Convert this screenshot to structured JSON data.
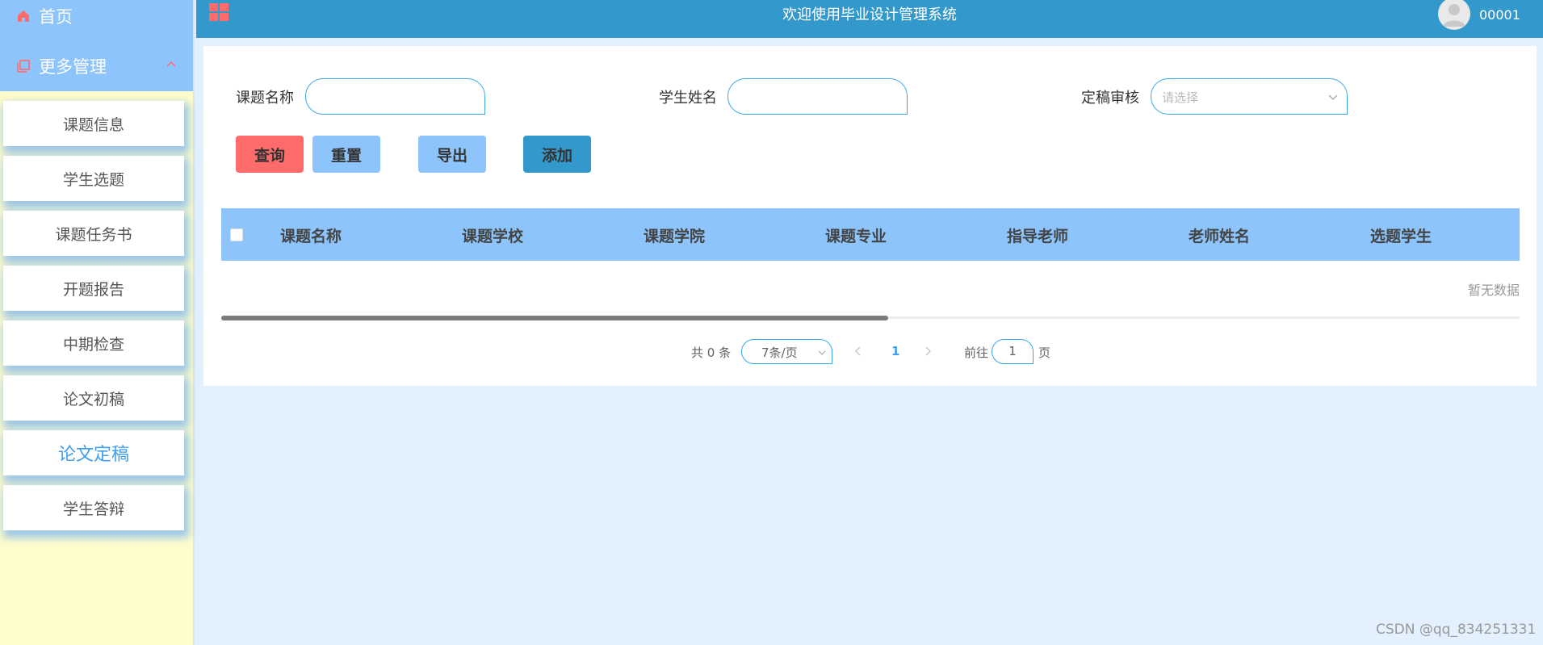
{
  "sidebar": {
    "home_label": "首页",
    "more_label": "更多管理",
    "items": [
      {
        "label": "课题信息"
      },
      {
        "label": "学生选题"
      },
      {
        "label": "课题任务书"
      },
      {
        "label": "开题报告"
      },
      {
        "label": "中期检查"
      },
      {
        "label": "论文初稿"
      },
      {
        "label": "论文定稿"
      },
      {
        "label": "学生答辩"
      }
    ],
    "active_item": "论文定稿"
  },
  "topbar": {
    "title": "欢迎使用毕业设计管理系统",
    "username": "00001"
  },
  "search": {
    "field1_label": "课题名称",
    "field1_value": "",
    "field2_label": "学生姓名",
    "field2_value": "",
    "field3_label": "定稿审核",
    "field3_placeholder": "请选择"
  },
  "buttons": {
    "query": "查询",
    "reset": "重置",
    "export": "导出",
    "add": "添加"
  },
  "table": {
    "columns": [
      "课题名称",
      "课题学校",
      "课题学院",
      "课题专业",
      "指导老师",
      "老师姓名",
      "选题学生"
    ],
    "rows": [],
    "empty_text": "暂无数据"
  },
  "pagination": {
    "total_text": "共 0 条",
    "page_size": "7条/页",
    "current_page": "1",
    "goto_label": "前往",
    "goto_value": "1",
    "page_suffix": "页"
  },
  "watermark": "CSDN @qq_834251331",
  "colors": {
    "sidebar_header": "#8cc4fb",
    "sidebar_bg": "#fffdcc",
    "topbar": "#3399cc",
    "query_button": "#ff6b6b",
    "accent": "#3f9ef0"
  }
}
